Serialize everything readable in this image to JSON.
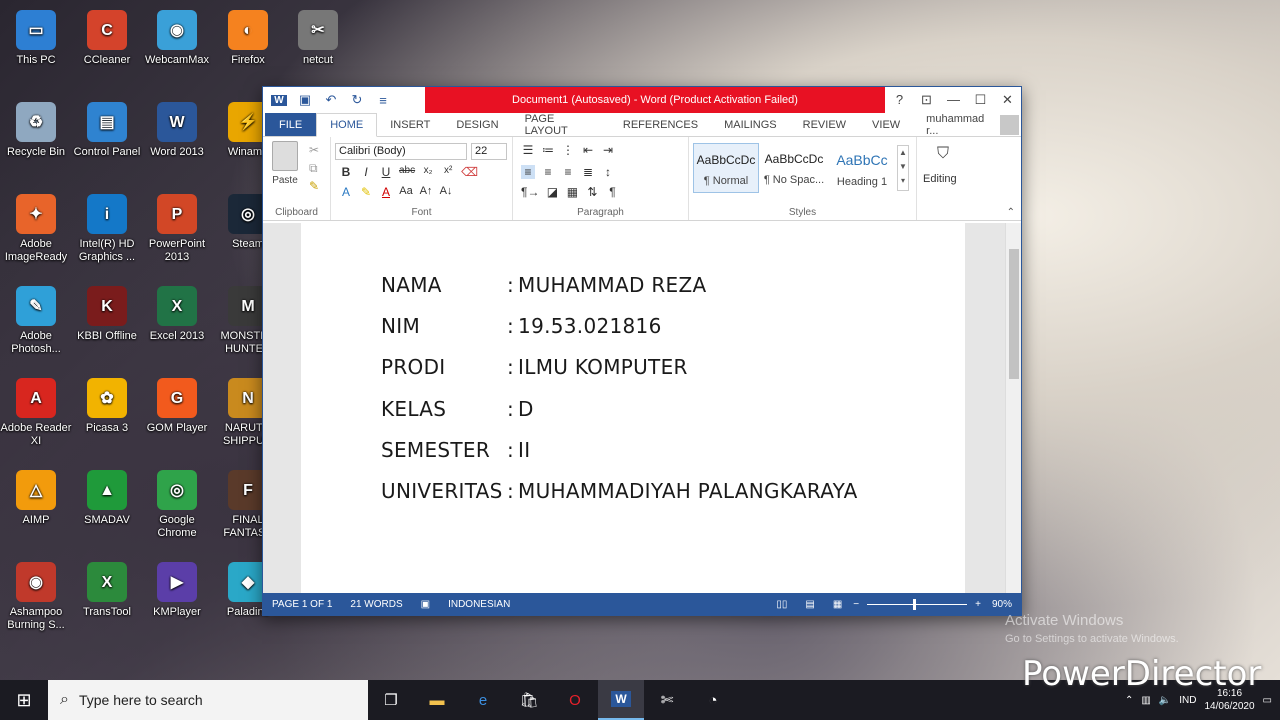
{
  "desktop": {
    "icons": [
      {
        "label": "This PC",
        "icon": "computer-icon",
        "color": "#2d7fd3",
        "glyph": "▭"
      },
      {
        "label": "CCleaner",
        "icon": "ccleaner-icon",
        "color": "#d4432b",
        "glyph": "C"
      },
      {
        "label": "WebcamMax",
        "icon": "webcam-icon",
        "color": "#3aa0d8",
        "glyph": "◉"
      },
      {
        "label": "Firefox",
        "icon": "firefox-icon",
        "color": "#f5821f",
        "glyph": "◐"
      },
      {
        "label": "netcut",
        "icon": "netcut-icon",
        "color": "#777777",
        "glyph": "✂"
      },
      {
        "label": "Recycle Bin",
        "icon": "recycle-bin-icon",
        "color": "#8fa8c0",
        "glyph": "♻"
      },
      {
        "label": "Control Panel",
        "icon": "control-panel-icon",
        "color": "#2f83d0",
        "glyph": "▤"
      },
      {
        "label": "Word 2013",
        "icon": "word-icon",
        "color": "#2b579a",
        "glyph": "W"
      },
      {
        "label": "Winamp",
        "icon": "winamp-icon",
        "color": "#e9a600",
        "glyph": "⚡"
      },
      {
        "label": "Adobe ImageReady",
        "icon": "imageready-icon",
        "color": "#e8642a",
        "glyph": "✦"
      },
      {
        "label": "Intel(R) HD Graphics ...",
        "icon": "intel-icon",
        "color": "#1478c8",
        "glyph": "i"
      },
      {
        "label": "PowerPoint 2013",
        "icon": "powerpoint-icon",
        "color": "#d24726",
        "glyph": "P"
      },
      {
        "label": "Steam",
        "icon": "steam-icon",
        "color": "#1b2838",
        "glyph": "◎"
      },
      {
        "label": "Adobe Photosh...",
        "icon": "photoshop-icon",
        "color": "#2fa0d8",
        "glyph": "✎"
      },
      {
        "label": "KBBI Offline",
        "icon": "kbbi-icon",
        "color": "#7a1c1c",
        "glyph": "K"
      },
      {
        "label": "Excel 2013",
        "icon": "excel-icon",
        "color": "#217346",
        "glyph": "X"
      },
      {
        "label": "MONSTER HUNTER",
        "icon": "monster-hunter-icon",
        "color": "#3a3a3a",
        "glyph": "M"
      },
      {
        "label": "Adobe Reader XI",
        "icon": "adobe-reader-icon",
        "color": "#d8261f",
        "glyph": "A"
      },
      {
        "label": "Picasa 3",
        "icon": "picasa-icon",
        "color": "#f2b300",
        "glyph": "✿"
      },
      {
        "label": "GOM Player",
        "icon": "gom-player-icon",
        "color": "#f25a1d",
        "glyph": "G"
      },
      {
        "label": "NARUTO SHIPPU...",
        "icon": "naruto-icon",
        "color": "#c98a1e",
        "glyph": "N"
      },
      {
        "label": "AIMP",
        "icon": "aimp-icon",
        "color": "#f29b0c",
        "glyph": "△"
      },
      {
        "label": "SMADAV",
        "icon": "smadav-icon",
        "color": "#1f9a3a",
        "glyph": "▲"
      },
      {
        "label": "Google Chrome",
        "icon": "chrome-icon",
        "color": "#2fa34a",
        "glyph": "◎"
      },
      {
        "label": "FINAL FANTASY",
        "icon": "final-fantasy-icon",
        "color": "#5a3a2a",
        "glyph": "F"
      },
      {
        "label": "Ashampoo Burning S...",
        "icon": "ashampoo-icon",
        "color": "#c0392b",
        "glyph": "◉"
      },
      {
        "label": "TransTool",
        "icon": "transtool-icon",
        "color": "#2c8a3c",
        "glyph": "X"
      },
      {
        "label": "KMPlayer",
        "icon": "kmplayer-icon",
        "color": "#5b3ea8",
        "glyph": "▶"
      },
      {
        "label": "Paladins",
        "icon": "paladins-icon",
        "color": "#2aa8c8",
        "glyph": "◆"
      }
    ]
  },
  "word": {
    "title": "Document1 (Autosaved) - Word (Product Activation Failed)",
    "help": "?",
    "tabs": [
      "FILE",
      "HOME",
      "INSERT",
      "DESIGN",
      "PAGE LAYOUT",
      "REFERENCES",
      "MAILINGS",
      "REVIEW",
      "VIEW"
    ],
    "user": "muhammad r...",
    "ribbon": {
      "clipboard_label": "Clipboard",
      "paste_label": "Paste",
      "font_label": "Font",
      "font_name": "Calibri (Body)",
      "font_size": "22",
      "paragraph_label": "Paragraph",
      "styles_label": "Styles",
      "styles": [
        {
          "preview": "AaBbCcDc",
          "name": "¶ Normal",
          "color": "#222222"
        },
        {
          "preview": "AaBbCcDc",
          "name": "¶ No Spac...",
          "color": "#222222"
        },
        {
          "preview": "AaBbCc",
          "name": "Heading 1",
          "color": "#2e74b5"
        }
      ],
      "editing_label": "Editing"
    },
    "document": {
      "lines": [
        {
          "label": "NAMA",
          "value": "MUHAMMAD REZA"
        },
        {
          "label": "NIM",
          "value": "19.53.021816"
        },
        {
          "label": "PRODI",
          "value": "ILMU  KOMPUTER"
        },
        {
          "label": "KELAS",
          "value": "D"
        },
        {
          "label": "SEMESTER",
          "value": "II"
        },
        {
          "label": "UNIVERITAS",
          "value": "MUHAMMADIYAH PALANGKARAYA"
        }
      ]
    },
    "status": {
      "page": "PAGE 1 OF 1",
      "words": "21 WORDS",
      "language": "INDONESIAN",
      "zoom": "90%"
    }
  },
  "taskbar": {
    "search_placeholder": "Type here to search",
    "language": "IND",
    "time": "16:16",
    "date": "14/06/2020"
  },
  "overlay": {
    "activate_title": "Activate Windows",
    "activate_sub": "Go to Settings to activate Windows.",
    "watermark": "PowerDirector"
  }
}
